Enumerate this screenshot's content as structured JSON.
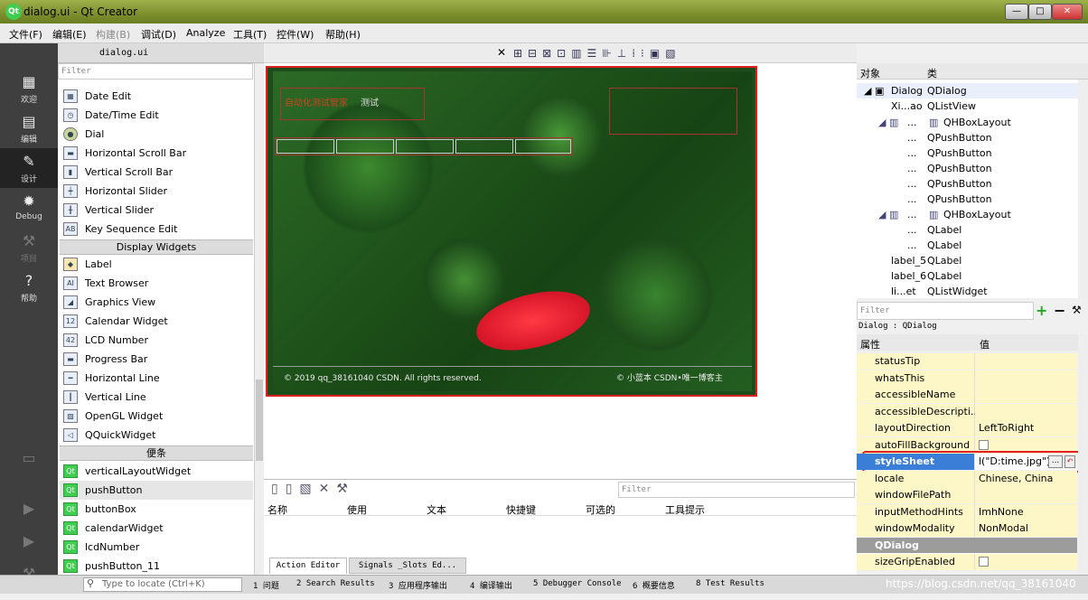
{
  "window": {
    "title": "dialog.ui - Qt Creator",
    "logo": "Qt",
    "min": "—",
    "max": "□",
    "close": "✕"
  },
  "menu": [
    "文件(F)",
    "编辑(E)",
    "构建(B)",
    "调试(D)",
    "Analyze",
    "工具(T)",
    "控件(W)",
    "帮助(H)"
  ],
  "modes": [
    {
      "label": "欢迎",
      "icon": "grid-icon"
    },
    {
      "label": "编辑",
      "icon": "edit-icon"
    },
    {
      "label": "设计",
      "icon": "pencil-icon"
    },
    {
      "label": "Debug",
      "icon": "bug-icon"
    },
    {
      "label": "项目",
      "icon": "wrench-icon"
    },
    {
      "label": "帮助",
      "icon": "help-icon"
    }
  ],
  "widgetbox": {
    "filter_placeholder": "Filter",
    "file": "dialog.ui",
    "items_top": [
      "Date Edit",
      "Date/Time Edit",
      "Dial",
      "Horizontal Scroll Bar",
      "Vertical Scroll Bar",
      "Horizontal Slider",
      "Vertical Slider",
      "Key Sequence Edit"
    ],
    "cat_display": "Display Widgets",
    "items_display": [
      "Label",
      "Text Browser",
      "Graphics View",
      "Calendar Widget",
      "LCD Number",
      "Progress Bar",
      "Horizontal Line",
      "Vertical Line",
      "OpenGL Widget",
      "QQuickWidget"
    ],
    "cat_scratch": "便条",
    "items_scratch": [
      "verticalLayoutWidget",
      "pushButton",
      "buttonBox",
      "calendarWidget",
      "lcdNumber",
      "pushButton_11"
    ]
  },
  "form": {
    "label_title": "自动化测试管家",
    "label_small": "测试",
    "footer_left": "© 2019 qq_38161040 CSDN. All rights reserved.",
    "footer_right": "© 小蓝本 CSDN•唯一博客主"
  },
  "objects": {
    "header_obj": "对象",
    "header_cls": "类",
    "rows": [
      [
        "Dialog",
        "QDialog"
      ],
      [
        "Xi...ao",
        "QListView"
      ],
      [
        "...",
        "QHBoxLayout"
      ],
      [
        "...",
        "QPushButton"
      ],
      [
        "...",
        "QPushButton"
      ],
      [
        "...",
        "QPushButton"
      ],
      [
        "...",
        "QPushButton"
      ],
      [
        "...",
        "QPushButton"
      ],
      [
        "...",
        "QHBoxLayout"
      ],
      [
        "...",
        "QLabel"
      ],
      [
        "...",
        "QLabel"
      ],
      [
        "label_5",
        "QLabel"
      ],
      [
        "label_6",
        "QLabel"
      ],
      [
        "li...et",
        "QListWidget"
      ]
    ]
  },
  "props": {
    "filter": "Filter",
    "context": "Dialog : QDialog",
    "header_name": "属性",
    "header_val": "值",
    "rows": [
      [
        "statusTip",
        ""
      ],
      [
        "whatsThis",
        ""
      ],
      [
        "accessibleName",
        ""
      ],
      [
        "accessibleDescripti...",
        ""
      ],
      [
        "layoutDirection",
        "LeftToRight"
      ],
      [
        "autoFillBackground",
        ""
      ],
      [
        "styleSheet",
        "l(\"D:time.jpg\");"
      ],
      [
        "locale",
        "Chinese, China"
      ],
      [
        "windowFilePath",
        ""
      ],
      [
        "inputMethodHints",
        "ImhNone"
      ],
      [
        "windowModality",
        "NonModal"
      ],
      [
        "QDialog",
        ""
      ],
      [
        "sizeGripEnabled",
        ""
      ]
    ]
  },
  "actioneditor": {
    "filter": "Filter",
    "cols": [
      "名称",
      "使用",
      "文本",
      "快捷键",
      "可选的",
      "工具提示"
    ],
    "tabs": [
      "Action Editor",
      "Signals _Slots Ed..."
    ]
  },
  "statusbar": {
    "locate": "Type to locate (Ctrl+K)",
    "panes": [
      "1 问题",
      "2 Search Results",
      "3 应用程序输出",
      "4 编译输出",
      "5 Debugger Console",
      "6 概要信息",
      "8 Test Results"
    ],
    "watermark": "https://blog.csdn.net/qq_38161040"
  }
}
